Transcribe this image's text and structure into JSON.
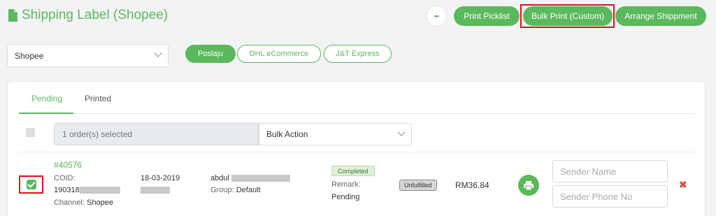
{
  "header": {
    "title": "Shipping Label (Shopee)",
    "more_label": "•••",
    "print_picklist": "Print Picklist",
    "bulk_print_custom": "Bulk Print (Custom)",
    "arrange_shipment": "Arrange Shippment"
  },
  "filters": {
    "store_select": "Shopee",
    "couriers": [
      "Poslaju",
      "DHL eCommerce",
      "J&T Express"
    ],
    "active_courier": "Poslaju"
  },
  "tabs": [
    "Pending",
    "Printed"
  ],
  "selection": {
    "count_text": "1 order(s) selected",
    "bulk_action_label": "Bulk Action"
  },
  "order": {
    "id": "#40576",
    "coid_label": "COID:",
    "coid_prefix": "190318",
    "channel_label": "Channel:",
    "channel": "Shopee",
    "date": "18-03-2019",
    "customer_first": "abdul",
    "group_label": "Group:",
    "group": "Default",
    "status_badge": "Completed",
    "remark_label": "Remark:",
    "remark": "Pending",
    "fulfillment": "Unfulfilled",
    "amount": "RM36.84",
    "sender_name_placeholder": "Sender Name",
    "sender_phone_placeholder": "Sender Phone No",
    "delete_label": "✖"
  },
  "colors": {
    "accent": "#5cb85c",
    "highlight": "#e0101a",
    "danger": "#d9534f"
  }
}
